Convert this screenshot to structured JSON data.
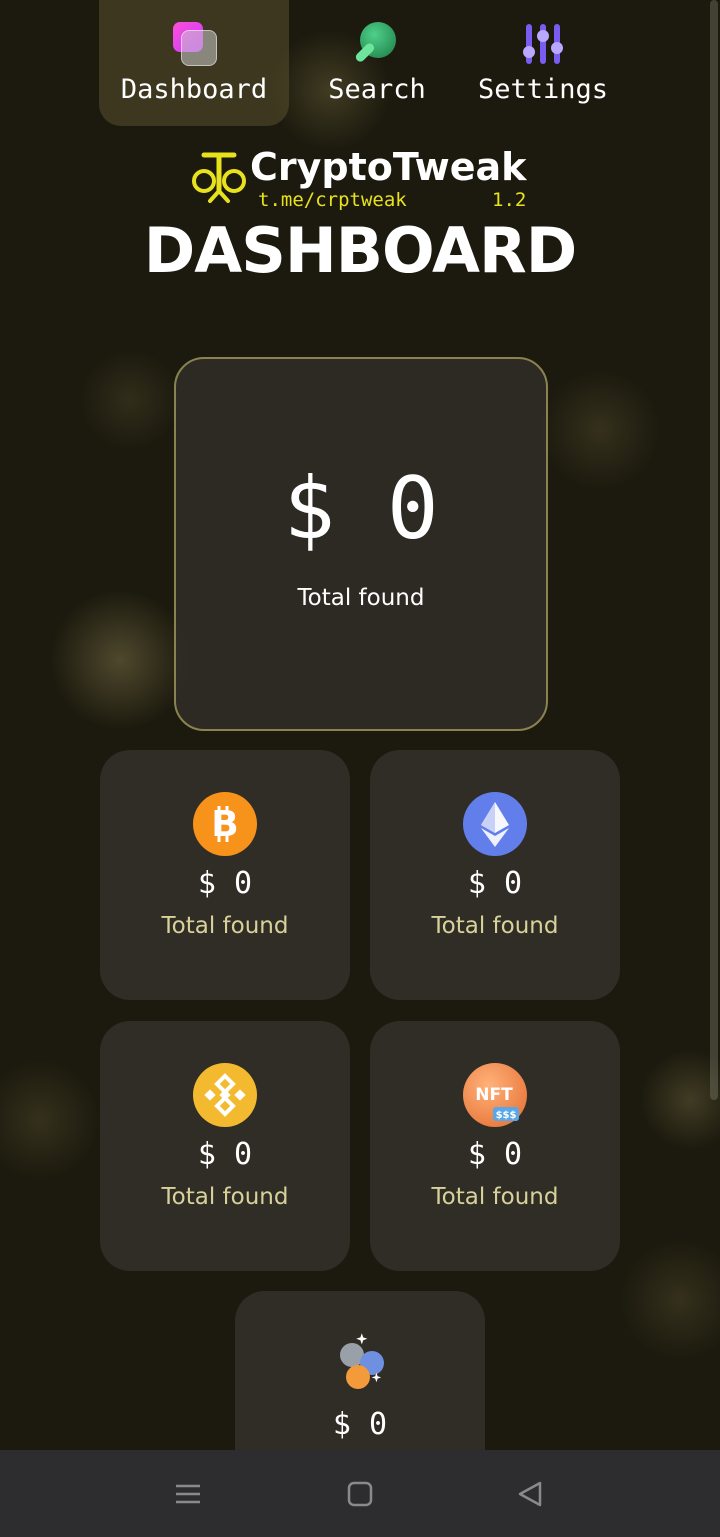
{
  "nav": {
    "items": [
      {
        "label": "Dashboard",
        "icon": "dashboard-icon",
        "active": true
      },
      {
        "label": "Search",
        "icon": "search-icon",
        "active": false
      },
      {
        "label": "Settings",
        "icon": "settings-sliders-icon",
        "active": false
      }
    ]
  },
  "brand": {
    "name": "CryptoTweak",
    "link": "t.me/crptweak",
    "version": "1.2",
    "accent_color": "#e8e21c"
  },
  "page_title": "DASHBOARD",
  "total": {
    "amount": "$ 0",
    "label": "Total found"
  },
  "coins": [
    {
      "icon": "bitcoin-icon",
      "color": "#f7931a",
      "amount": "$ 0",
      "label": "Total found"
    },
    {
      "icon": "ethereum-icon",
      "color": "#627eea",
      "amount": "$ 0",
      "label": "Total found"
    },
    {
      "icon": "binance-icon",
      "color": "#f3ba2f",
      "amount": "$ 0",
      "label": "Total found"
    },
    {
      "icon": "nft-icon",
      "color": "#f08a4b",
      "amount": "$ 0",
      "label": "Total found"
    },
    {
      "icon": "multi-coin-icon",
      "color": "#8da3d8",
      "amount": "$ 0"
    }
  ],
  "nft_badge": {
    "text": "NFT",
    "sub": "$$$"
  },
  "system_nav": [
    "menu-icon",
    "home-icon",
    "back-icon"
  ]
}
